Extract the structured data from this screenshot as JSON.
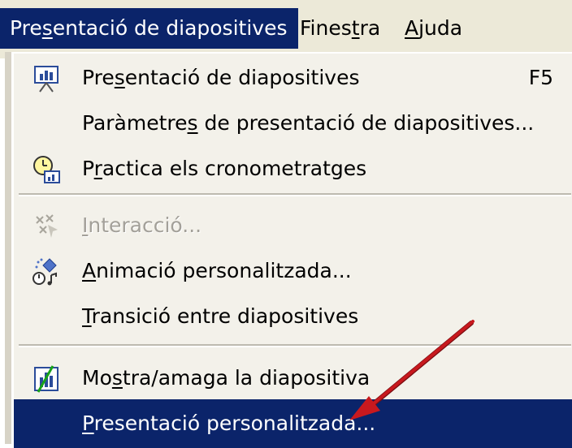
{
  "menubar": {
    "items": [
      {
        "label": "Presentació de diapositives",
        "underline": "s",
        "active": true
      },
      {
        "label": "Finestra",
        "underline": "r",
        "active": false
      },
      {
        "label": "Ajuda",
        "underline": "j",
        "active": false
      }
    ]
  },
  "menu": {
    "items": [
      {
        "label": "Presentació de diapositives",
        "shortcut": "F5",
        "icon": "slideshow-icon",
        "enabled": true
      },
      {
        "label": "Paràmetres de presentació de diapositives...",
        "shortcut": "",
        "icon": "",
        "enabled": true
      },
      {
        "label": "Practica els cronometratges",
        "shortcut": "",
        "icon": "rehearse-timings-icon",
        "enabled": true
      },
      {
        "label": "Interacció...",
        "shortcut": "",
        "icon": "interaction-icon",
        "enabled": false
      },
      {
        "label": "Animació personalitzada...",
        "shortcut": "",
        "icon": "custom-animation-icon",
        "enabled": true
      },
      {
        "label": "Transició entre diapositives",
        "shortcut": "",
        "icon": "",
        "enabled": true
      },
      {
        "label": "Mostra/amaga la diapositiva",
        "shortcut": "",
        "icon": "hide-slide-icon",
        "enabled": true
      },
      {
        "label": "Presentació personalitzada...",
        "shortcut": "",
        "icon": "",
        "enabled": true,
        "highlighted": true
      }
    ]
  },
  "colors": {
    "highlight": "#0b246a",
    "menu_bg": "#f3f1ea",
    "arrow": "#c8191e"
  }
}
